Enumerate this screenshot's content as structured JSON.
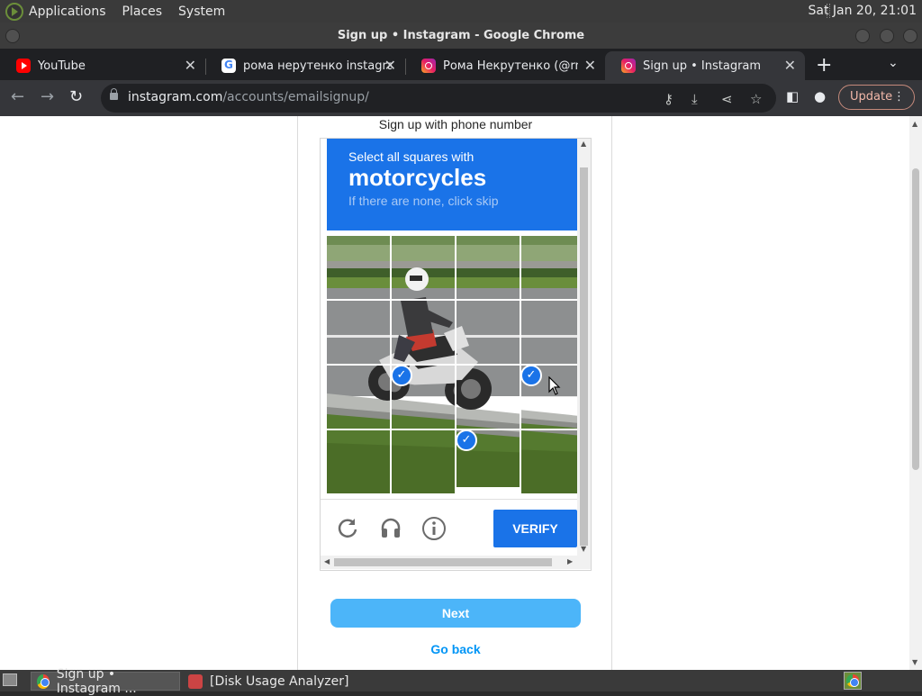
{
  "system_panel": {
    "menus": [
      "Applications",
      "Places",
      "System"
    ],
    "clock": "Sat Jan 20, 21:01"
  },
  "window": {
    "title": "Sign up • Instagram - Google Chrome"
  },
  "tabs": [
    {
      "label": "YouTube",
      "icon": "youtube-icon"
    },
    {
      "label": "рома нерутенко instagram",
      "icon": "google-icon"
    },
    {
      "label": "Рома Некрутенко (@rnekrutenko",
      "icon": "instagram-icon"
    },
    {
      "label": "Sign up • Instagram",
      "icon": "instagram-icon",
      "active": true
    }
  ],
  "toolbar": {
    "url_host": "instagram.com",
    "url_path": "/accounts/emailsignup/",
    "update_label": "Update"
  },
  "page": {
    "signup_phone": "Sign up with phone number",
    "captcha": {
      "instruction": "Select all squares with",
      "target": "motorcycles",
      "hint": "If there are none, click skip",
      "verify_label": "VERIFY",
      "grid_rows": 4,
      "grid_cols": 4,
      "selected_tiles": [
        [
          2,
          1
        ],
        [
          2,
          3
        ],
        [
          3,
          2
        ]
      ]
    },
    "next_label": "Next",
    "go_back_label": "Go back"
  },
  "taskbar": {
    "tasks": [
      {
        "label": "Sign up • Instagram ...",
        "icon": "chrome-icon",
        "active": true
      },
      {
        "label": "[Disk Usage Analyzer]",
        "icon": "disk-usage-icon",
        "active": false
      }
    ]
  },
  "colors": {
    "captcha_blue": "#1a73e8",
    "next_button": "#4cb5f9",
    "link": "#0095f6"
  }
}
